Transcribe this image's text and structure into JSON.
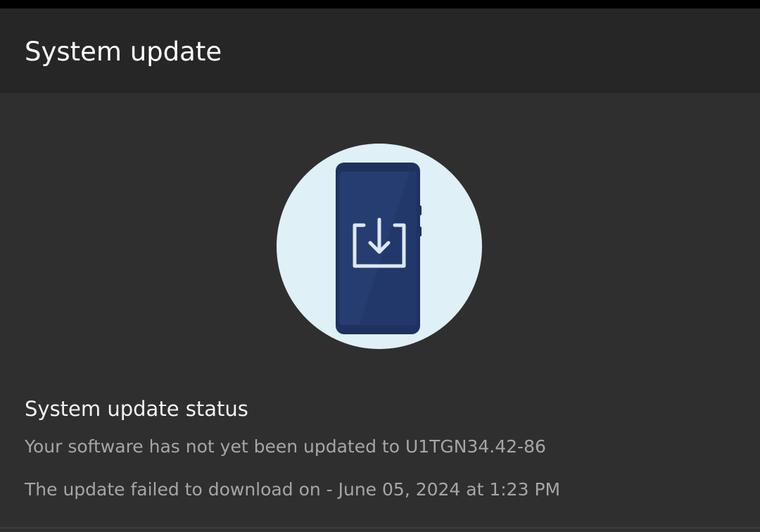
{
  "app_bar": {
    "title": "System update"
  },
  "illustration": {
    "icon": "phone-download-icon",
    "circle_color": "#dff0f7",
    "phone_color": "#1e3260",
    "screen_color": "#263d72",
    "glyph_color": "#dde8f5"
  },
  "status": {
    "title": "System update status",
    "message": "Your software has not yet been updated to U1TGN34.42-86",
    "failure": "The update failed to download on - June 05, 2024 at 1:23 PM"
  }
}
